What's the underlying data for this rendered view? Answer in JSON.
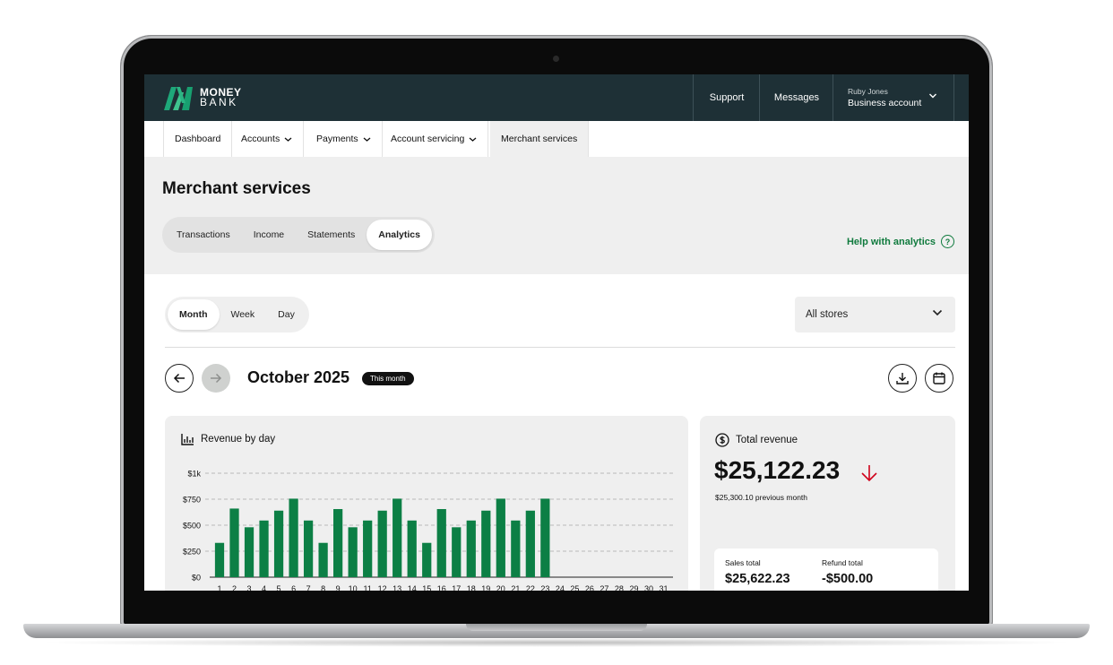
{
  "brand": {
    "line1": "MONEY",
    "line2": "BANK"
  },
  "topbar": {
    "support": "Support",
    "messages": "Messages",
    "user_name": "Ruby Jones",
    "account_type": "Business account"
  },
  "nav": {
    "items": [
      {
        "label": "Dashboard"
      },
      {
        "label": "Accounts"
      },
      {
        "label": "Payments"
      },
      {
        "label": "Account servicing"
      },
      {
        "label": "Merchant services"
      }
    ],
    "active": "Merchant services"
  },
  "page": {
    "title": "Merchant services",
    "tabs": [
      "Transactions",
      "Income",
      "Statements",
      "Analytics"
    ],
    "active_tab": "Analytics",
    "help_link": "Help with analytics",
    "help_icon": "?"
  },
  "filters": {
    "periods": [
      "Month",
      "Week",
      "Day"
    ],
    "active_period": "Month",
    "store_select": "All stores"
  },
  "period_header": {
    "title": "October 2025",
    "badge": "This month"
  },
  "revenue_card": {
    "title": "Revenue by day"
  },
  "total_card": {
    "title": "Total revenue",
    "value": "$25,122.23",
    "trend": "down",
    "previous": "$25,300.10 previous month",
    "sales_label": "Sales total",
    "sales_value": "$25,622.23",
    "refund_label": "Refund total",
    "refund_value": "-$500.00"
  },
  "colors": {
    "topbar_bg": "#1e3036",
    "accent_green": "#0f7a3d",
    "bar_green": "#0c7f45",
    "trend_red": "#d0021b"
  },
  "chart_data": {
    "type": "bar",
    "title": "Revenue by day",
    "categories": [
      "1",
      "2",
      "3",
      "4",
      "5",
      "6",
      "7",
      "8",
      "9",
      "10",
      "11",
      "12",
      "13",
      "14",
      "15",
      "16",
      "17",
      "18",
      "19",
      "20",
      "21",
      "22",
      "23",
      "24",
      "25",
      "26",
      "27",
      "28",
      "29",
      "30",
      "31"
    ],
    "values": [
      330,
      660,
      480,
      545,
      640,
      755,
      545,
      330,
      655,
      480,
      545,
      640,
      755,
      545,
      330,
      655,
      480,
      545,
      640,
      755,
      545,
      640,
      755,
      null,
      null,
      null,
      null,
      null,
      null,
      null,
      null
    ],
    "y_ticks": [
      "$0",
      "$250",
      "$500",
      "$750",
      "$1k"
    ],
    "ylim": [
      0,
      1000
    ],
    "grid": true
  }
}
